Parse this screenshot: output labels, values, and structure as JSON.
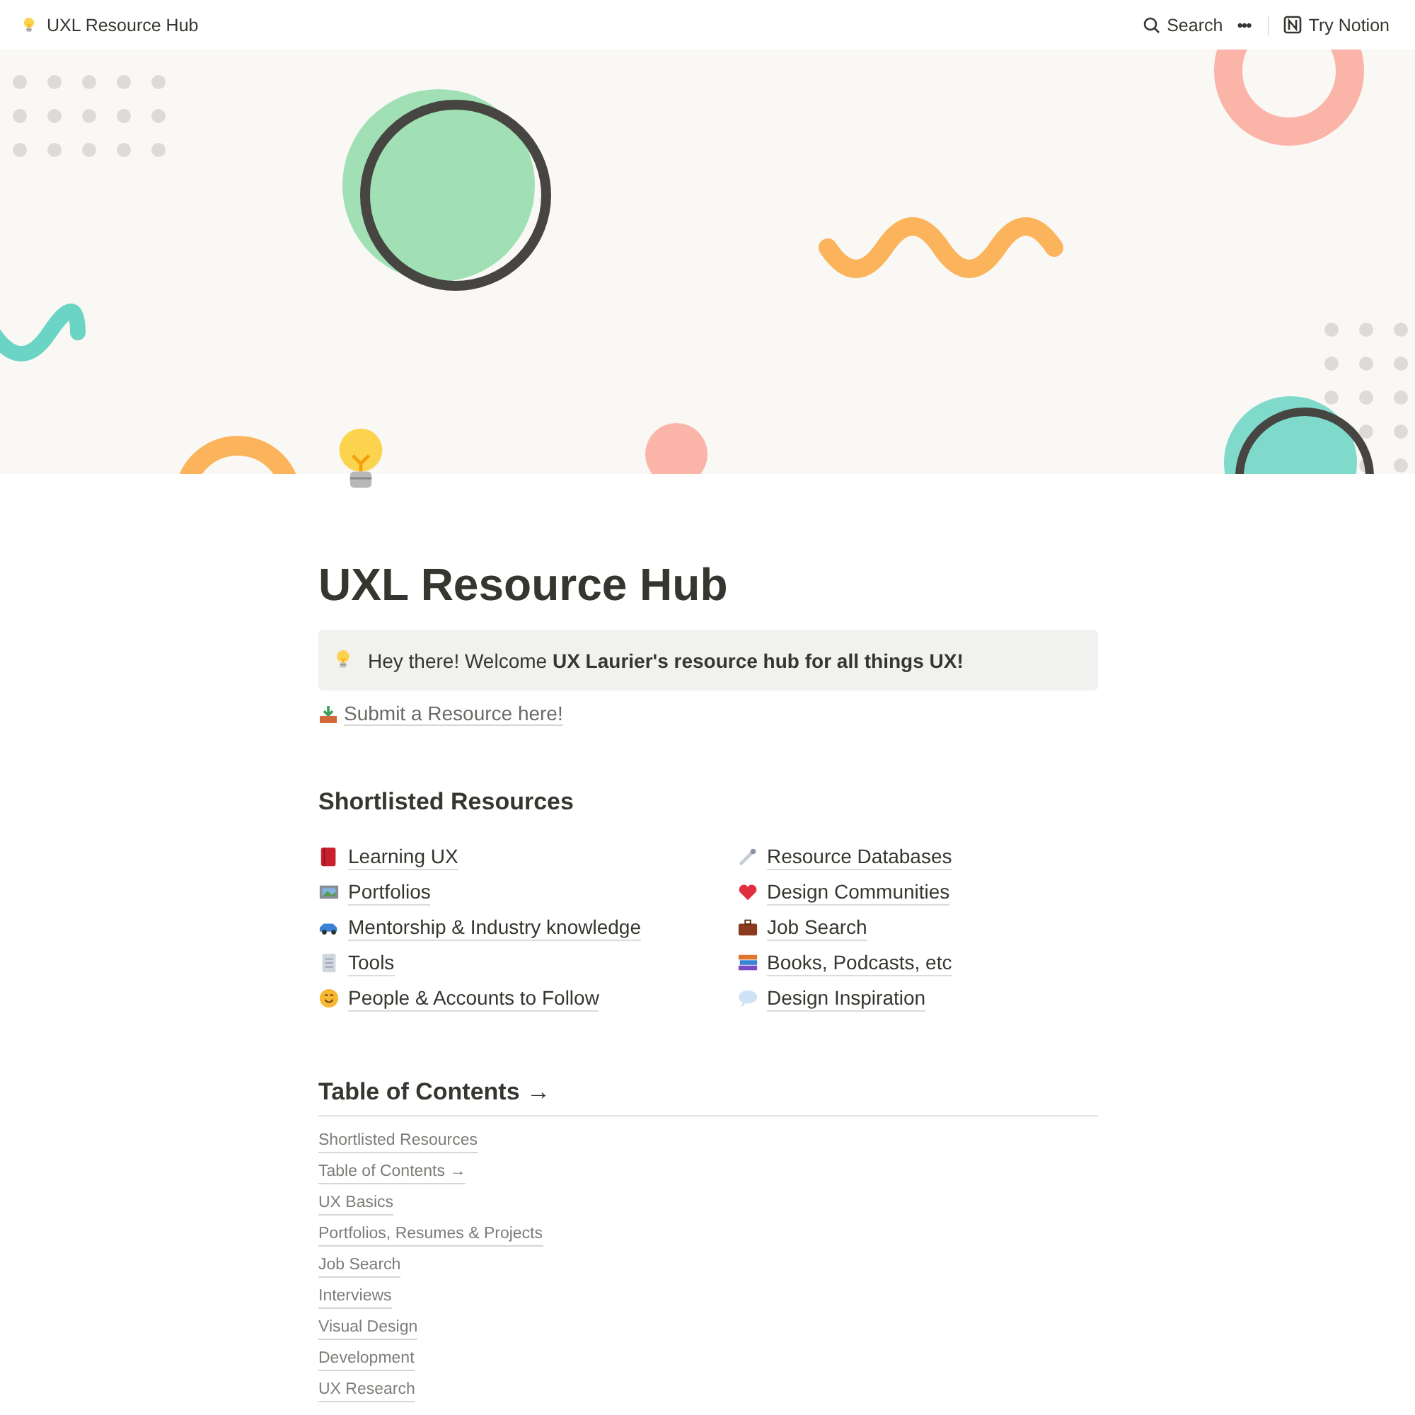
{
  "topbar": {
    "title": "UXL Resource Hub",
    "search": "Search",
    "more": "•••",
    "try": "Try Notion"
  },
  "page": {
    "title": "UXL Resource Hub",
    "callout": "Hey there! Welcome **UX Laurier's resource hub for all things UX!**",
    "submit_link": "Submit a Resource here!"
  },
  "shortlisted": {
    "heading": "Shortlisted Resources",
    "columns": [
      [
        "Learning UX",
        "Portfolios",
        "Mentorship & Industry knowledge",
        "Tools",
        "People & Accounts to Follow"
      ],
      [
        "Resource Databases",
        "Design Communities",
        "Job Search",
        "Books, Podcasts, etc",
        "Design Inspiration"
      ]
    ]
  },
  "toc": {
    "heading": "Table of Contents →",
    "items": [
      "Shortlisted Resources",
      "Table of Contents →",
      "UX Basics",
      "Portfolios, Resumes & Projects",
      "Job Search",
      "Interviews",
      "Visual Design",
      "Development",
      "UX Research"
    ]
  }
}
